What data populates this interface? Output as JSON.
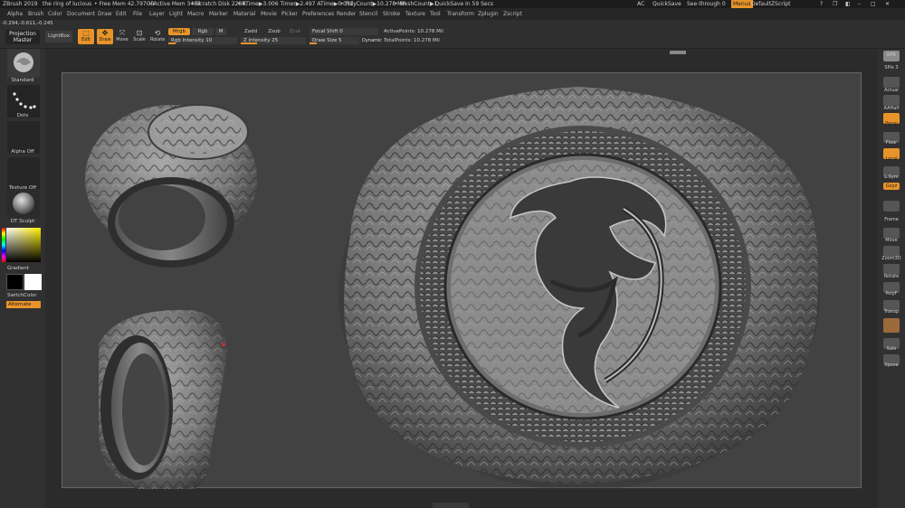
{
  "titlebar": {
    "app": "ZBrush 2019",
    "doc": "the ring of lucious",
    "free_mem": "• Free Mem 42.797GB",
    "active_mem": "• Active Mem 3484",
    "scratch": "• Scratch Disk 2284",
    "rtime": "• RTime▶3.006 Timer▶2.497 ATime▶0.031",
    "polycount": "• PolyCount▶10.278 MP",
    "meshcount": "• MeshCount▶1",
    "quicksave_in": "• QuickSave In 59 Secs",
    "ac": "AC",
    "quicksave": "QuickSave",
    "see_through": "See-through  0",
    "menus": "Menus",
    "script": "DefaultZScript"
  },
  "menu": [
    "Alpha",
    "Brush",
    "Color",
    "Document",
    "Draw",
    "Edit",
    "File",
    "Layer",
    "Light",
    "Macro",
    "Marker",
    "Material",
    "Movie",
    "Picker",
    "Preferences",
    "Render",
    "Stencil",
    "Stroke",
    "Texture",
    "Tool",
    "Transform",
    "Zplugin",
    "Zscript"
  ],
  "toolbar": {
    "projection_master": "Projection Master",
    "lightbox": "LightBox",
    "edit": "Edit",
    "draw": "Draw",
    "move": "Move",
    "scale": "Scale",
    "rotate": "Rotate",
    "mrgb": "Mrgb",
    "rgb": "Rgb",
    "m": "M",
    "rgb_intensity": "Rgb Intensity 10",
    "zadd": "Zadd",
    "zsub": "Zsub",
    "zcut": "Zcut",
    "z_intensity": "Z Intensity 25",
    "focal_shift": "Focal Shift 0",
    "draw_size": "Draw Size 5",
    "dynamic": "Dynamic",
    "active_points": "ActivePoints: 10.278 Mil",
    "total_points": "TotalPoints: 10.278 Mil",
    "coords": "-0.294,-0.611,-0.245"
  },
  "levels": {
    "rgb_intensity": 0.1,
    "z_intensity": 0.25
  },
  "left": {
    "standard": "Standard",
    "dots": "Dots",
    "alpha_off": "Alpha Off",
    "texture_off": "Texture Off",
    "material": "DT Sculpt",
    "gradient": "Gradient",
    "switch_color": "SwitchColor",
    "alternate": "Alternate"
  },
  "right": [
    {
      "name": "bpr",
      "label": "BPR"
    },
    {
      "name": "spix",
      "label": "SPix  3"
    },
    {
      "name": "actual",
      "label": "Actual"
    },
    {
      "name": "aahalf",
      "label": "AAHalf"
    },
    {
      "name": "persp",
      "label": "Persp"
    },
    {
      "name": "floor",
      "label": "Floor"
    },
    {
      "name": "local",
      "label": "Local"
    },
    {
      "name": "lsym",
      "label": "L.Sym"
    },
    {
      "name": "xyz",
      "label": "Gxyz"
    },
    {
      "name": "frame",
      "label": "Frame"
    },
    {
      "name": "move",
      "label": "Move"
    },
    {
      "name": "zoom3d",
      "label": "Zoom3D"
    },
    {
      "name": "rotate",
      "label": "Rotate"
    },
    {
      "name": "polyf",
      "label": "PolyF"
    },
    {
      "name": "transp",
      "label": "Transp"
    },
    {
      "name": "solo",
      "label": "Solo"
    },
    {
      "name": "xpose",
      "label": "Xpose"
    }
  ],
  "colors": {
    "accent": "#e8942a",
    "panel": "#303030",
    "canvas": "#424242",
    "metal": "#8a8a8a"
  }
}
